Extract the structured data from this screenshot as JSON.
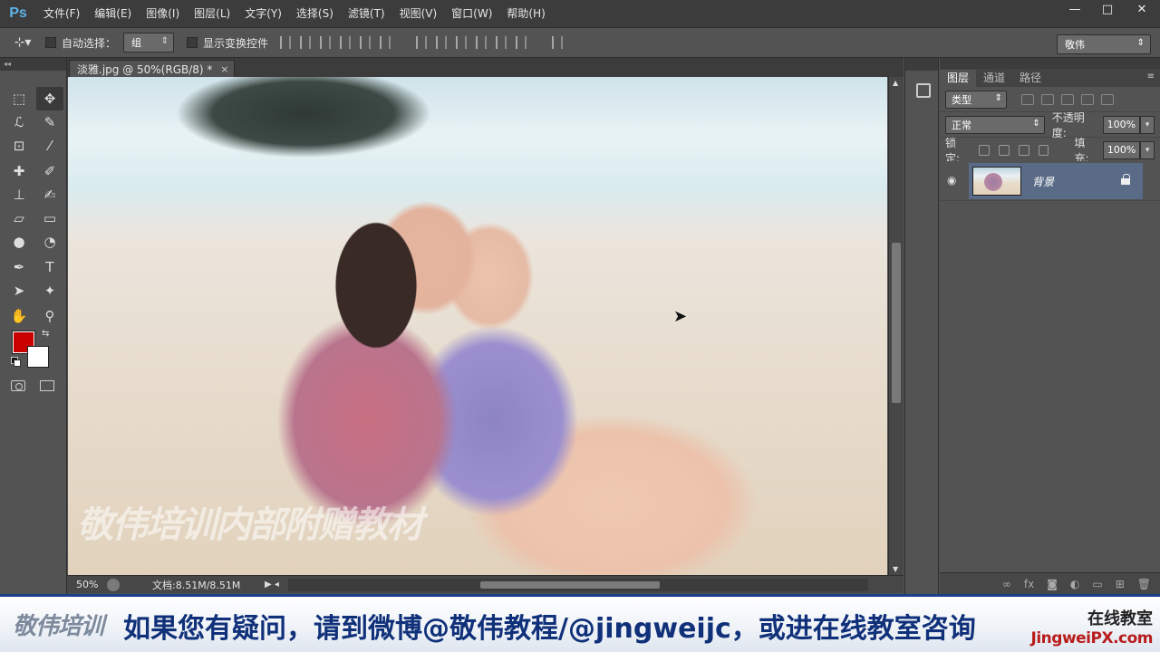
{
  "app": {
    "logo": "Ps",
    "menus": [
      "文件(F)",
      "编辑(E)",
      "图像(I)",
      "图层(L)",
      "文字(Y)",
      "选择(S)",
      "滤镜(T)",
      "视图(V)",
      "窗口(W)",
      "帮助(H)"
    ],
    "window_controls": [
      "—",
      "□",
      "✕"
    ]
  },
  "options": {
    "tool_icon": "move-tool-icon",
    "auto_select_label": "自动选择：",
    "auto_select_value": "组",
    "show_transform_label": "显示变换控件",
    "workspace": "敬伟"
  },
  "document": {
    "tab_title": "淡雅.jpg @ 50%(RGB/8) *",
    "tab_close": "×",
    "zoom": "50%",
    "doc_size": "文档:8.51M/8.51M",
    "watermark": "敬伟培训内部附赠教材"
  },
  "layers": {
    "tabs": [
      "图层",
      "通道",
      "路径"
    ],
    "filter_kind": "类型",
    "blend_mode": "正常",
    "opacity_label": "不透明度:",
    "opacity_value": "100%",
    "lock_label": "锁定:",
    "fill_label": "填充:",
    "fill_value": "100%",
    "layer_name": "背景",
    "bottom_icons": [
      "∞",
      "fx",
      "◙",
      "◐",
      "▭",
      "⊞",
      "🗑"
    ]
  },
  "banner": {
    "logo": "敬伟培训",
    "message": "如果您有疑问，请到微博@敬伟教程/@jingweijc，或进在线教室咨询",
    "brand_top": "在线教室",
    "brand_bottom": "JingweiPX.com"
  },
  "colors": {
    "foreground": "#c80000",
    "background": "#ffffff",
    "accent_selected_layer": "#596b87"
  }
}
